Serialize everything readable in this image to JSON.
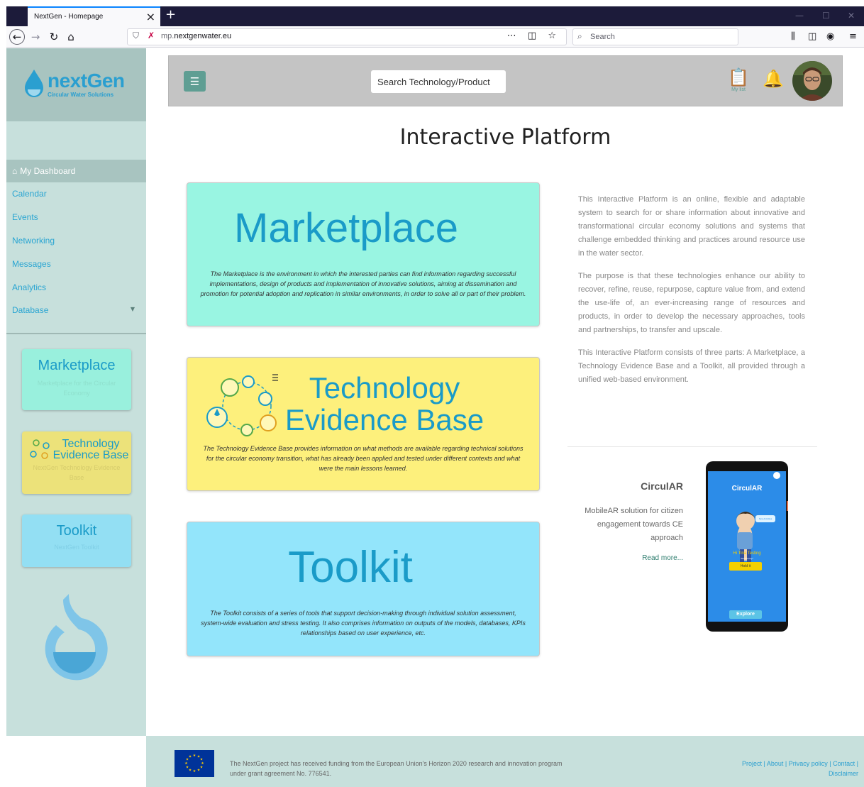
{
  "browser": {
    "tab_title": "NextGen - Homepage",
    "url_prefix": "mp.",
    "url_domain": "nextgenwater.eu",
    "search_placeholder": "Search"
  },
  "sidebar": {
    "logo_word": "nextGen",
    "logo_tagline": "Circular Water Solutions",
    "items": [
      {
        "label": "My Dashboard"
      },
      {
        "label": "Calendar"
      },
      {
        "label": "Events"
      },
      {
        "label": "Networking"
      },
      {
        "label": "Messages"
      },
      {
        "label": "Analytics"
      },
      {
        "label": "Database"
      }
    ],
    "cards": [
      {
        "title": "Marketplace",
        "subtitle": "Marketplace for the Circular Economy"
      },
      {
        "title_line1": "Technology",
        "title_line2": "Evidence Base",
        "subtitle": "NextGen Technology Evidence Base"
      },
      {
        "title": "Toolkit",
        "subtitle": "NextGen Toolkit"
      }
    ]
  },
  "header": {
    "search_placeholder": "Search Technology/Product",
    "my_list_label": "My list"
  },
  "main": {
    "title": "Interactive Platform",
    "cards": [
      {
        "title": "Marketplace",
        "description": "The Marketplace is the environment in which the interested parties can find information regarding successful implementations, design of products and implementation of innovative solutions, aiming at dissemination and promotion for potential adoption and replication in similar environments, in order to solve all or part of their problem."
      },
      {
        "title_line1": "Technology",
        "title_line2": "Evidence Base",
        "description": "The Technology Evidence Base provides information on what methods are available regarding technical solutions for the circular economy transition, what has already been applied and tested under different contexts and what were the main lessons learned."
      },
      {
        "title": "Toolkit",
        "description": "The Toolkit consists of a series of tools that support decision-making through individual solution assessment, system-wide evaluation and stress testing. It also comprises information on outputs of the models, databases, KPIs relationships based on user experience, etc."
      }
    ],
    "about": [
      "This Interactive Platform is an online, flexible and adaptable system to search for or share information about innovative and transformational circular economy solutions and systems that challenge embedded thinking and practices around resource use in the water sector.",
      "The purpose is that these technologies enhance our ability to recover, refine, reuse, repurpose, capture value from, and extend the use-life of, an ever-increasing range of resources and products, in order to develop the necessary approaches, tools and partnerships, to transfer and upscale.",
      "This Interactive Platform consists of three parts: A Marketplace, a Technology Evidence Base and a Toolkit, all provided through a unified web-based environment."
    ],
    "circular": {
      "title": "CirculAR",
      "description": "MobileAR solution for citizen engagement towards CE approach",
      "link": "Read more...",
      "phone_title": "CirculAR",
      "phone_bubble": "New Activities",
      "phone_greeting": "Hi Tina Testing",
      "phone_question": "Would bring?",
      "phone_button": "Hold it",
      "phone_explore": "Explore"
    }
  },
  "footer": {
    "funding_text": "The NextGen project has received funding from the European Union's Horizon 2020 research and innovation program under grant agreement No. 776541.",
    "links": [
      "Project",
      "About",
      "Privacy policy",
      "Contact",
      "Disclaimer"
    ]
  },
  "colors": {
    "accent": "#1a9bc8",
    "sidebar_bg": "#c7e0dc",
    "marketplace_bg": "#99f5e2",
    "evidence_bg": "#fdf07c",
    "toolkit_bg": "#93e5fb",
    "header_bg": "#c4c4c4",
    "button_green": "#5f9e93"
  }
}
